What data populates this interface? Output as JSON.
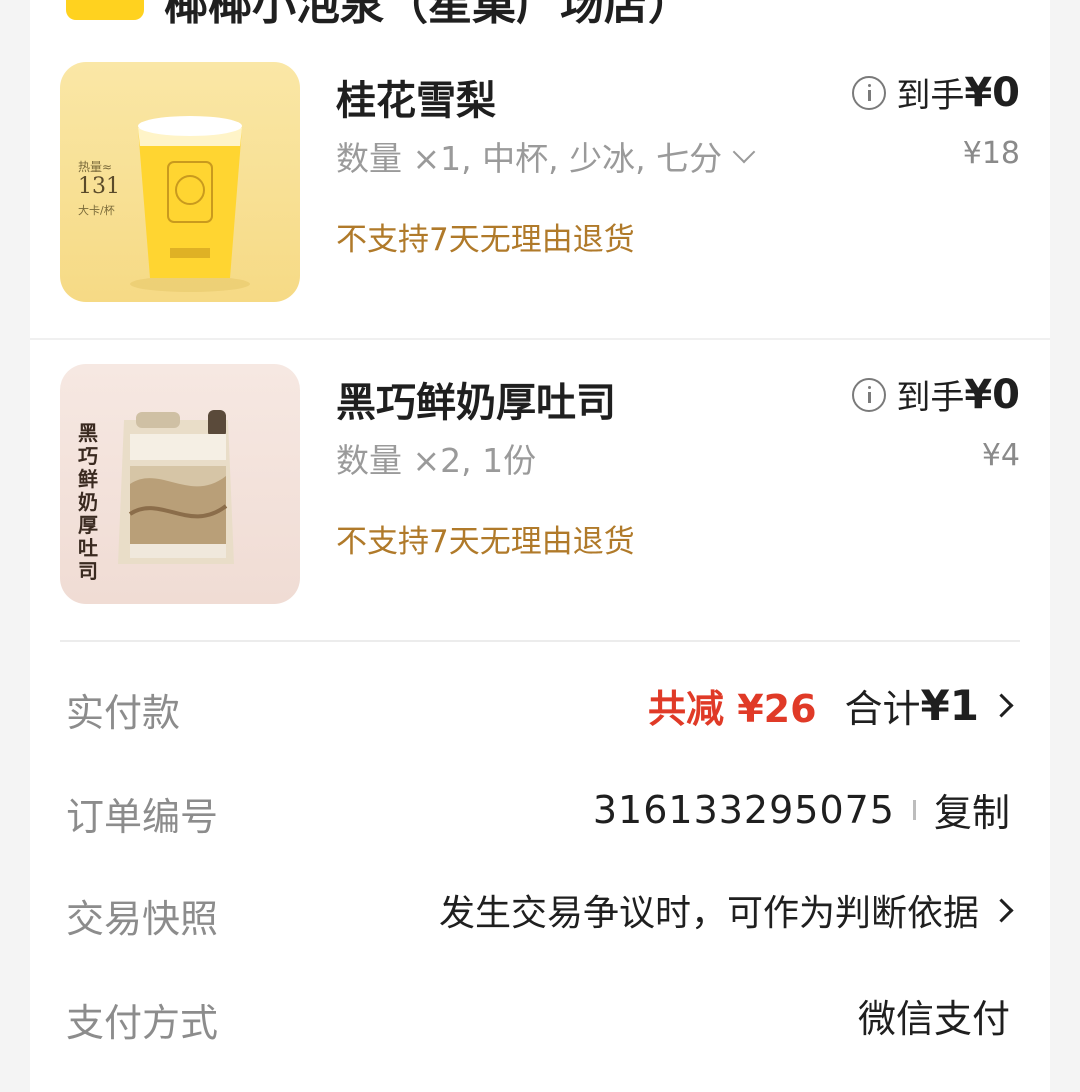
{
  "store": {
    "name": "椰椰小泡泉（星巢广场店）"
  },
  "items": [
    {
      "name": "桂花雪梨",
      "spec": "数量 ×1, 中杯, 少冰, 七分",
      "policy": "不支持7天无理由退货",
      "final_label": "到手",
      "final_price": "¥0",
      "original_price": "¥18",
      "thumb_text": {
        "kcal_label": "热量≈",
        "kcal_value": "131",
        "kcal_unit": "大卡/杯"
      }
    },
    {
      "name": "黑巧鲜奶厚吐司",
      "spec": "数量 ×2, 1份",
      "policy": "不支持7天无理由退货",
      "final_label": "到手",
      "final_price": "¥0",
      "original_price": "¥4",
      "thumb_text": {
        "vertical_title": "黑巧鲜奶厚吐司"
      }
    }
  ],
  "summary": {
    "paid_label": "实付款",
    "reduce_text": "共减 ¥26",
    "total_label": "合计",
    "total_value": "¥1",
    "order_label": "订单编号",
    "order_number": "316133295075",
    "copy_label": "复制",
    "snapshot_label": "交易快照",
    "snapshot_text": "发生交易争议时，可作为判断依据",
    "pay_label": "支付方式",
    "pay_method": "微信支付"
  },
  "colors": {
    "accent_red": "#e03a27",
    "policy_brown": "#b07a2a",
    "store_tag": "#ffd21f"
  }
}
